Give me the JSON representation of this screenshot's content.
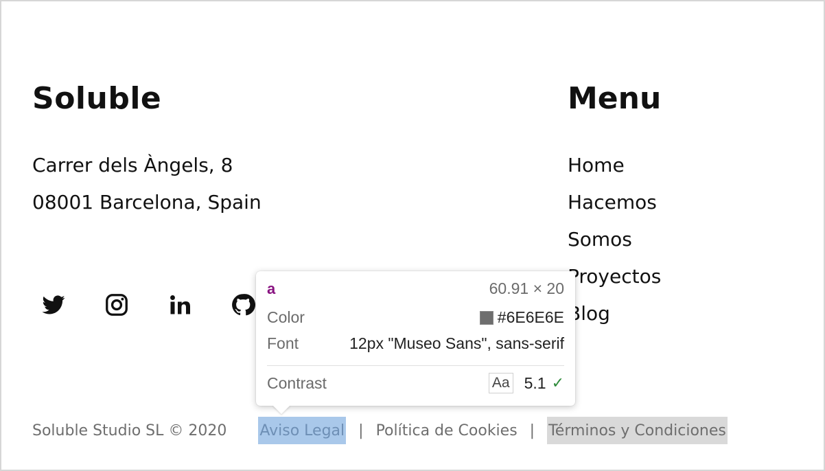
{
  "brand": {
    "title": "Soluble",
    "address_line1": "Carrer dels Àngels, 8",
    "address_line2": "08001 Barcelona, Spain"
  },
  "menu": {
    "title": "Menu",
    "items": [
      "Home",
      "Hacemos",
      "Somos",
      "Proyectos",
      "Blog"
    ]
  },
  "social": {
    "icons": [
      "twitter-icon",
      "instagram-icon",
      "linkedin-icon",
      "github-icon"
    ]
  },
  "footer": {
    "copyright": "Soluble Studio SL © 2020",
    "links": [
      "Aviso Legal",
      "Política de Cookies",
      "Términos y Condiciones"
    ],
    "separator": "|"
  },
  "inspector_tooltip": {
    "tag": "a",
    "dimensions": "60.91 × 20",
    "color_label": "Color",
    "color_value": "#6E6E6E",
    "font_label": "Font",
    "font_value": "12px \"Museo Sans\", sans-serif",
    "contrast_label": "Contrast",
    "contrast_badge": "Aa",
    "contrast_value": "5.1"
  },
  "colors": {
    "text_gray": "#6E6E6E",
    "highlight_blue": "#A9C8EA",
    "hover_gray": "#D9D9D9",
    "tag_purple": "#881280"
  }
}
